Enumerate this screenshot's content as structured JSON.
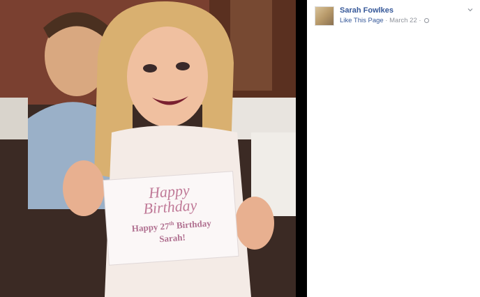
{
  "post": {
    "author": "Sarah Fowlkes",
    "like_page": "Like This Page",
    "separator": " · ",
    "date": "March 22",
    "dot": " · "
  },
  "photo": {
    "card_script_line1": "Happy",
    "card_script_line2": "Birthday",
    "card_line1_prefix": "Happy 27",
    "card_line1_sup": "th",
    "card_line1_suffix": " Birthday",
    "card_line2": "Sarah!"
  },
  "icons": [
    "chevron-down-icon",
    "globe-icon"
  ],
  "colors": {
    "link": "#365899",
    "meta": "#90949c",
    "card_text": "#b07090"
  }
}
